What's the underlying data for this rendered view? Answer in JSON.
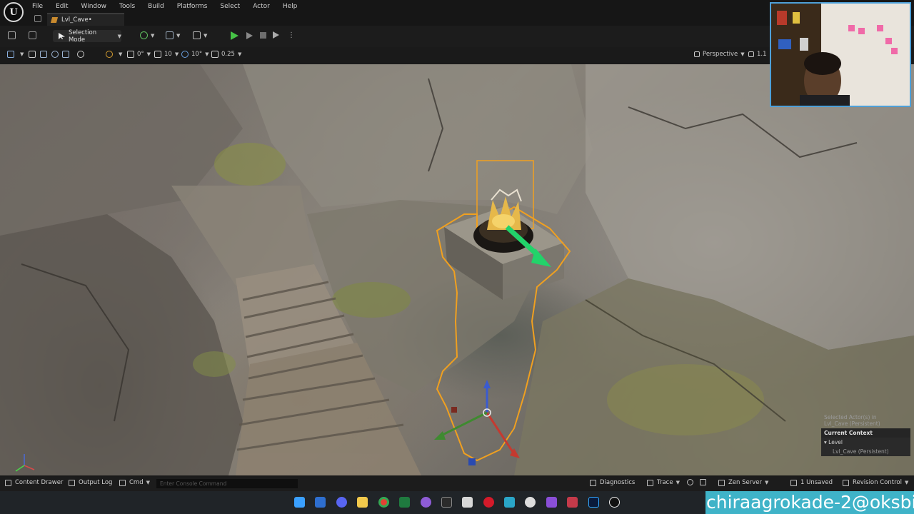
{
  "menu": [
    "File",
    "Edit",
    "Window",
    "Tools",
    "Build",
    "Platforms",
    "Select",
    "Actor",
    "Help"
  ],
  "tab": {
    "level": "Lvl_Cave•"
  },
  "toolbar": {
    "selection_mode": "Selection Mode"
  },
  "viewport_toolbar": {
    "rotation_snap": "0°",
    "grid": "10",
    "angle": "10°",
    "scale": "0.25",
    "view_mode": "Perspective",
    "camera_speed": "1.1"
  },
  "outliner": {
    "selected_line1": "Selected Actor(s) in",
    "selected_line2": "Lvl_Cave (Persistent)",
    "current_context": "Current Context",
    "level": "Level",
    "level_name": "Lvl_Cave (Persistent)"
  },
  "bottom": {
    "content_drawer": "Content Drawer",
    "output_log": "Output Log",
    "cmd": "Cmd",
    "console_placeholder": "Enter Console Command",
    "diagnostics": "Diagnostics",
    "trace": "Trace",
    "zen_server": "Zen Server",
    "unsaved": "1 Unsaved",
    "revision_control": "Revision Control"
  },
  "watermark": "chiraagrokade-2@oksbi",
  "colors": {
    "selection_outline": "#f0a020",
    "gizmo_green": "#22d36a",
    "watermark_bg": "#3fb3c8",
    "webcam_border": "#4ea0d8"
  },
  "taskbar_icons": [
    "windows-start-icon",
    "outlook-icon",
    "discord-icon",
    "file-explorer-icon",
    "chrome-icon",
    "excel-icon",
    "github-icon",
    "terminal-icon",
    "snipping-icon",
    "opera-icon",
    "photos-icon",
    "obs-icon",
    "visual-studio-icon",
    "davinci-icon",
    "photoshop-icon",
    "unreal-engine-icon"
  ]
}
